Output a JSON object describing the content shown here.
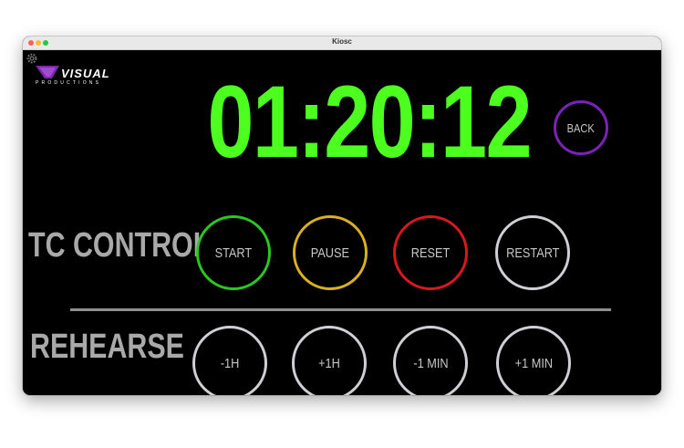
{
  "window": {
    "title": "Kiosc"
  },
  "logo": {
    "name": "VISUAL",
    "sub": "PRODUCTIONS"
  },
  "timer": {
    "value": "01:20:12",
    "color": "#4cff1f"
  },
  "back_button": {
    "label": "BACK",
    "color": "#7a22b8"
  },
  "tc_control": {
    "label": "TC CONTROL",
    "buttons": [
      {
        "label": "START",
        "color": "#28c81e"
      },
      {
        "label": "PAUSE",
        "color": "#d9b01e"
      },
      {
        "label": "RESET",
        "color": "#d8181e"
      },
      {
        "label": "RESTART",
        "color": "#cfcfd6"
      }
    ]
  },
  "rehearse": {
    "label": "REHEARSE",
    "buttons": [
      {
        "label": "-1H"
      },
      {
        "label": "+1H"
      },
      {
        "label": "-1 MIN"
      },
      {
        "label": "+1 MIN"
      }
    ]
  },
  "icons": {
    "settings": "gear-icon",
    "logo_mark": "visual-productions-logo"
  }
}
